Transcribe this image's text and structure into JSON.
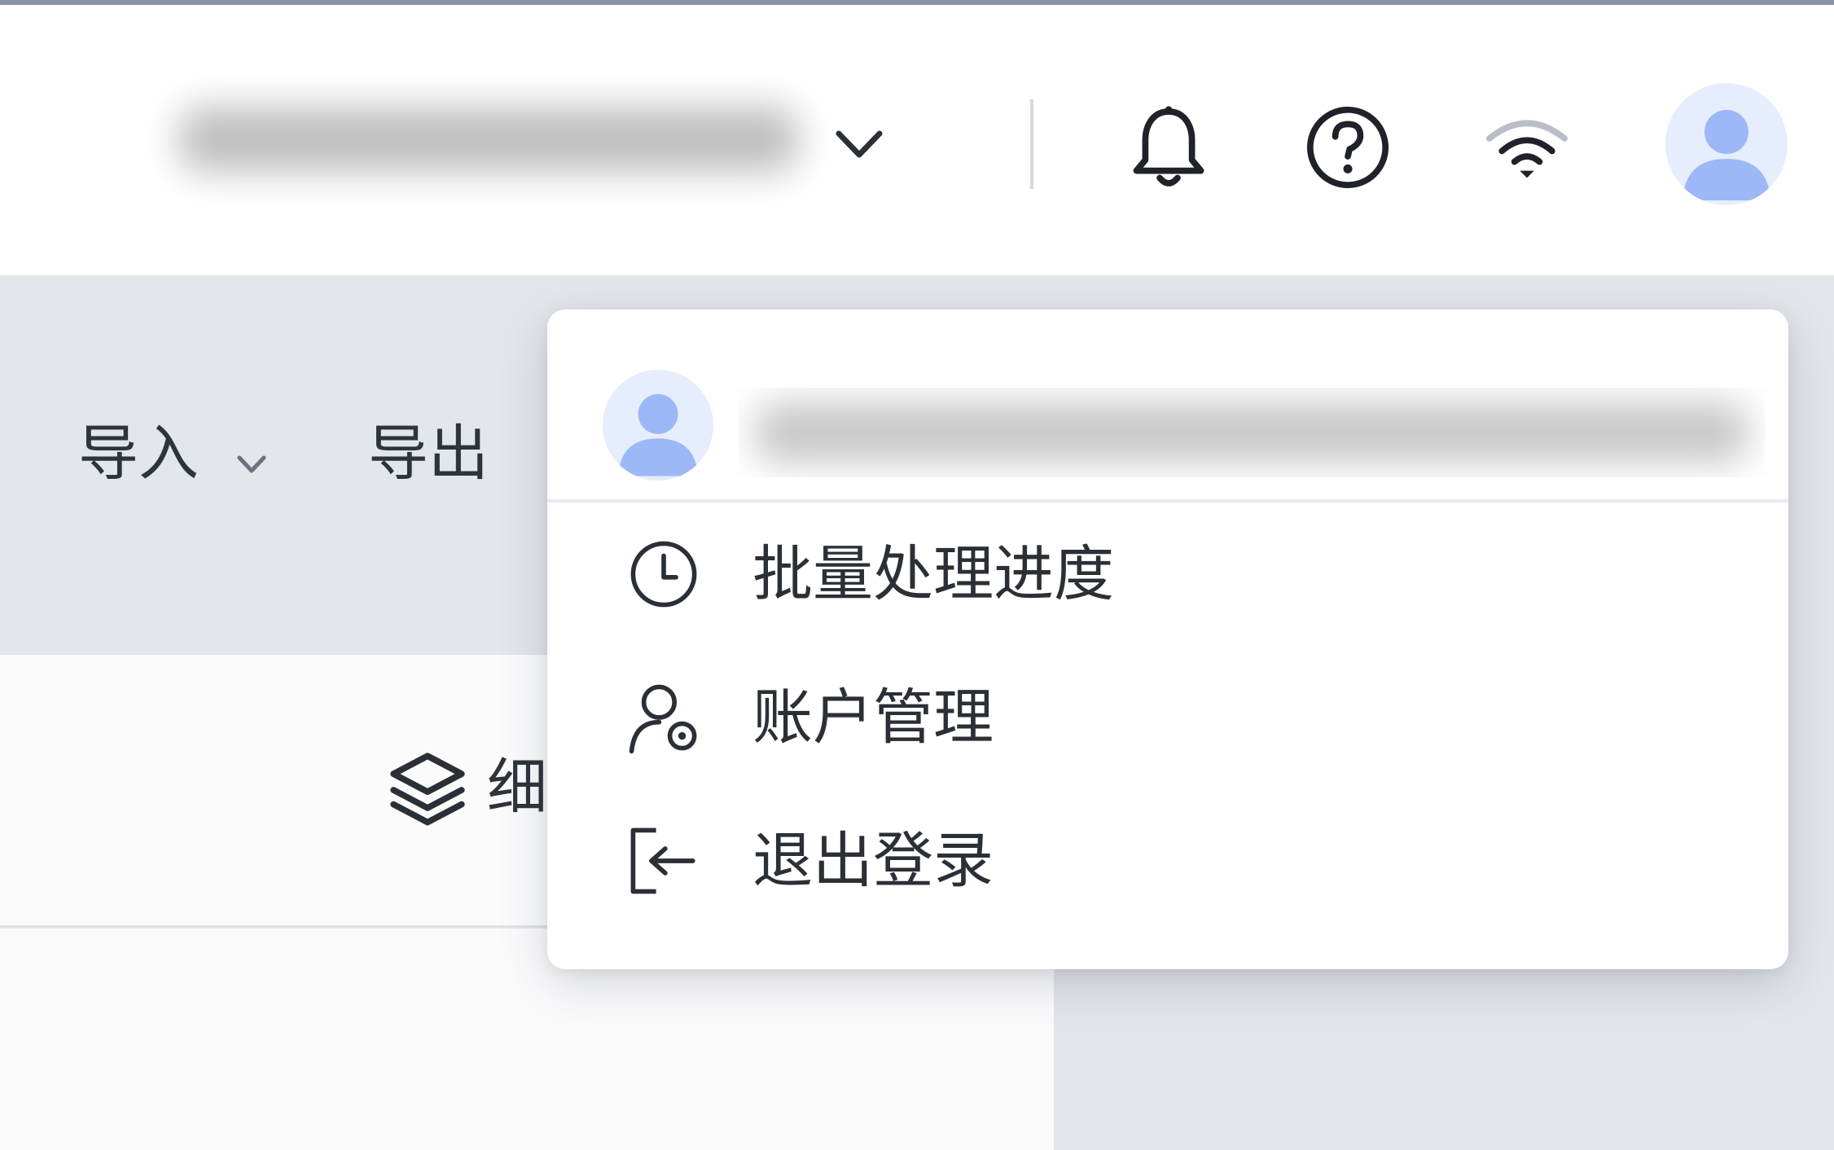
{
  "header": {
    "workspace_selector": {
      "value_obscured": true
    },
    "icons": [
      "bell-icon",
      "help-circle-icon",
      "wifi-icon",
      "user-avatar-icon"
    ]
  },
  "toolbar": {
    "import_label": "导入",
    "export_label": "导出"
  },
  "content": {
    "detail_label_partial": "细"
  },
  "user_menu": {
    "username_obscured": true,
    "items": [
      {
        "label": "批量处理进度",
        "icon": "clock-icon"
      },
      {
        "label": "账户管理",
        "icon": "user-settings-icon"
      },
      {
        "label": "退出登录",
        "icon": "logout-icon"
      }
    ]
  },
  "colors": {
    "avatar_bg": "#e6edfc",
    "avatar_fg": "#9db8f6",
    "toolbar_bg": "#e3e6ea",
    "text": "#2b2f36"
  }
}
